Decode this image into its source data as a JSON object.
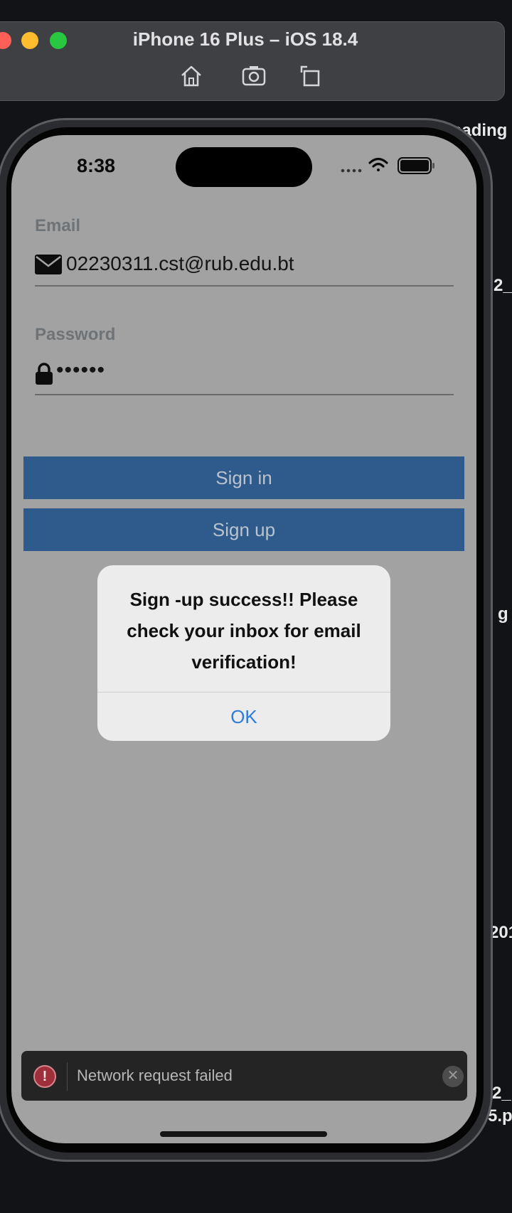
{
  "simulator": {
    "title": "iPhone 16 Plus – iOS 18.4",
    "toolbar": [
      "home-icon",
      "screenshot-icon",
      "rotate-icon"
    ]
  },
  "desktop": {
    "side_labels": [
      "eading",
      "2_",
      "g",
      "201",
      "2_",
      "5.p"
    ]
  },
  "status_bar": {
    "time": "8:38",
    "icons": [
      "cellular-icon",
      "wifi-icon",
      "battery-icon"
    ]
  },
  "form": {
    "email_label": "Email",
    "email_value": "02230311.cst@rub.edu.bt",
    "password_label": "Password",
    "password_value": "••••••",
    "signin_label": "Sign in",
    "signup_label": "Sign up"
  },
  "alert": {
    "message": "Sign -up success!! Please check your inbox for email verification!",
    "ok_label": "OK"
  },
  "toast": {
    "message": "Network request failed",
    "error_glyph": "!",
    "close_glyph": "✕"
  },
  "colors": {
    "button": "#2e5b8c",
    "alert_action": "#2f7bdb",
    "error": "#9f2f3a",
    "traffic_close": "#fe5f57",
    "traffic_minimize": "#febc2e",
    "traffic_zoom": "#28c840"
  }
}
